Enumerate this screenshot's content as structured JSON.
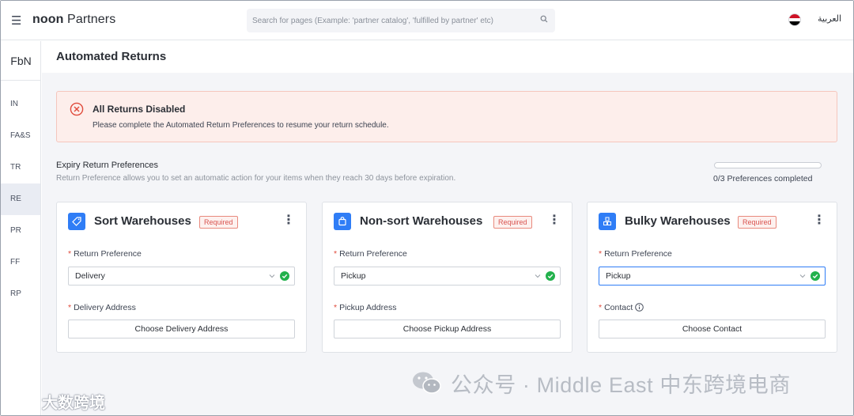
{
  "topbar": {
    "logo_bold": "noon",
    "logo_text": "Partners",
    "search_placeholder": "Search for pages (Example: 'partner catalog', 'fulfilled by partner' etc)",
    "language": "العربية"
  },
  "sidebar": {
    "header": "FbN",
    "items": [
      {
        "label": "IN",
        "active": false
      },
      {
        "label": "FA&S",
        "active": false
      },
      {
        "label": "TR",
        "active": false
      },
      {
        "label": "RE",
        "active": true
      },
      {
        "label": "PR",
        "active": false
      },
      {
        "label": "FF",
        "active": false
      },
      {
        "label": "RP",
        "active": false
      }
    ]
  },
  "page": {
    "title": "Automated Returns"
  },
  "alert": {
    "title": "All Returns Disabled",
    "text": "Please complete the Automated Return Preferences to resume your return schedule."
  },
  "preferences": {
    "heading": "Expiry Return Preferences",
    "subtext": "Return Preference allows you to set an automatic action for your items when they reach 30 days before expiration.",
    "progress_text": "0/3 Preferences completed",
    "progress_fraction": 0
  },
  "cards": [
    {
      "title": "Sort Warehouses",
      "badge": "Required",
      "pref_label": "Return Preference",
      "pref_value": "Delivery",
      "address_label": "Delivery Address",
      "button": "Choose Delivery Address",
      "icon": "tag-icon"
    },
    {
      "title": "Non-sort Warehouses",
      "badge": "Required",
      "pref_label": "Return Preference",
      "pref_value": "Pickup",
      "address_label": "Pickup Address",
      "button": "Choose Pickup Address",
      "icon": "bag-icon"
    },
    {
      "title": "Bulky Warehouses",
      "badge": "Required",
      "pref_label": "Return Preference",
      "pref_value": "Pickup",
      "address_label": "Contact",
      "button": "Choose Contact",
      "icon": "boxes-icon"
    }
  ],
  "watermarks": {
    "right": "公众号 · Middle East 中东跨境电商",
    "left": "大数跨境"
  },
  "colors": {
    "accent": "#2f7df6",
    "alert_bg": "#fdeeeb",
    "required": "#d9534f",
    "success": "#22b14c"
  }
}
